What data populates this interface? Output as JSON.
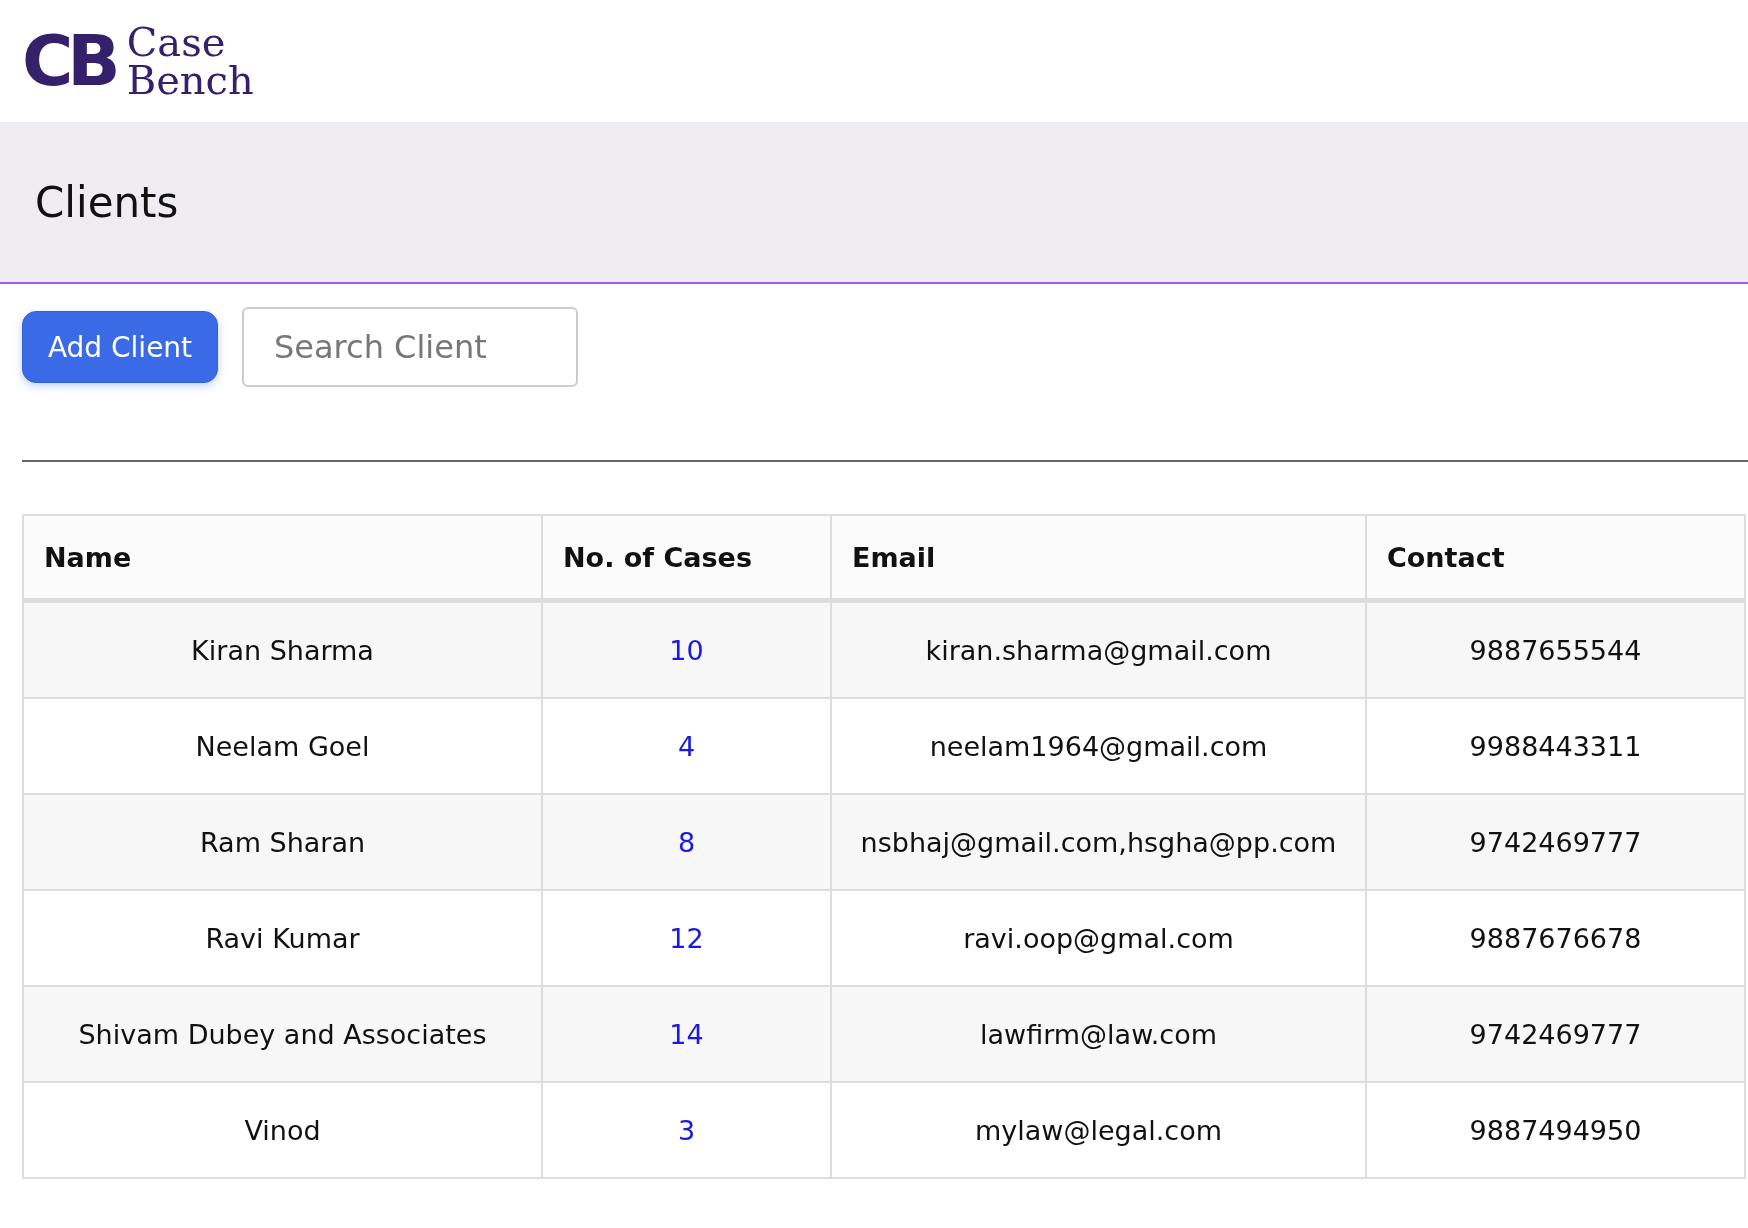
{
  "logo": {
    "mark": "CB",
    "line_1": "Case",
    "line_2": "Bench"
  },
  "page_title": "Clients",
  "add_button": "Add Client",
  "search": {
    "placeholder": "Search Client"
  },
  "table": {
    "columns": [
      "Name",
      "No. of Cases",
      "Email",
      "Contact"
    ],
    "rows": [
      {
        "name": "Kiran Sharma",
        "cases": "10",
        "email": "kiran.sharma@gmail.com",
        "contact": "9887655544"
      },
      {
        "name": "Neelam Goel",
        "cases": "4",
        "email": "neelam1964@gmail.com",
        "contact": "9988443311"
      },
      {
        "name": "Ram Sharan",
        "cases": "8",
        "email": "nsbhaj@gmail.com,hsgha@pp.com",
        "contact": "9742469777"
      },
      {
        "name": "Ravi Kumar",
        "cases": "12",
        "email": "ravi.oop@gmal.com",
        "contact": "9887676678"
      },
      {
        "name": "Shivam Dubey  and Associates",
        "cases": "14",
        "email": "lawfirm@law.com",
        "contact": "9742469777"
      },
      {
        "name": "Vinod",
        "cases": "3",
        "email": "mylaw@legal.com",
        "contact": "9887494950"
      }
    ]
  }
}
